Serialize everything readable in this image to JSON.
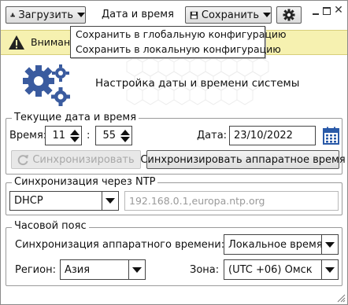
{
  "toolbar": {
    "load_label": "Загрузить",
    "title": "Дата и время",
    "save_label": "Сохранить"
  },
  "save_menu": {
    "items": [
      "Сохранить в глобальную конфигурацию",
      "Сохранить в локальную конфигурацию"
    ]
  },
  "warning": {
    "text": "Внимание"
  },
  "banner": {
    "title": "Настройка даты и времени системы"
  },
  "current": {
    "legend": "Текущие дата и время",
    "time_label": "Время:",
    "hours": "11",
    "separator": ":",
    "minutes": "55",
    "date_label": "Дата:",
    "date": "23/10/2022",
    "sync_button": "Синхронизировать",
    "sync_hw_button": "Синхронизировать аппаратное время"
  },
  "ntp": {
    "legend": "Синхронизация через NTP",
    "mode": "DHCP",
    "servers_placeholder": "192.168.0.1,europa.ntp.org"
  },
  "timezone": {
    "legend": "Часовой пояс",
    "hw_sync_label": "Синхронизация аппаратного времени:",
    "hw_sync_value": "Локальное время",
    "region_label": "Регион:",
    "region_value": "Азия",
    "zone_label": "Зона:",
    "zone_value": "(UTC +06) Омск"
  },
  "colors": {
    "accent_blue": "#3a5b9f",
    "warning_bg": "#f6f1b0",
    "calendar_blue": "#2a5aa8"
  }
}
